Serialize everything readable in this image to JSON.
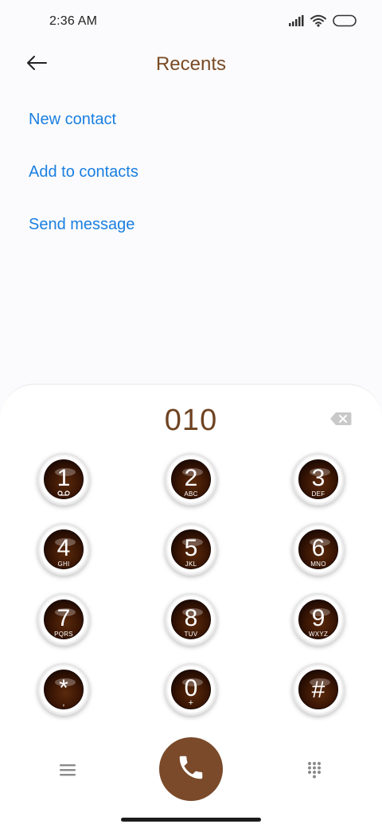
{
  "status_bar": {
    "time": "2:36 AM",
    "icons": [
      "signal-icon",
      "wifi-icon",
      "battery-icon"
    ]
  },
  "header": {
    "title": "Recents",
    "back_icon": "back-arrow-icon"
  },
  "options": [
    {
      "label": "New contact"
    },
    {
      "label": "Add to contacts"
    },
    {
      "label": "Send message"
    }
  ],
  "dialer": {
    "number": "010",
    "backspace_icon": "backspace-icon",
    "keys": [
      {
        "digit": "1",
        "letters": "voicemail"
      },
      {
        "digit": "2",
        "letters": "ABC"
      },
      {
        "digit": "3",
        "letters": "DEF"
      },
      {
        "digit": "4",
        "letters": "GHI"
      },
      {
        "digit": "5",
        "letters": "JKL"
      },
      {
        "digit": "6",
        "letters": "MNO"
      },
      {
        "digit": "7",
        "letters": "PQRS"
      },
      {
        "digit": "8",
        "letters": "TUV"
      },
      {
        "digit": "9",
        "letters": "WXYZ"
      },
      {
        "digit": "*",
        "letters": ","
      },
      {
        "digit": "0",
        "letters": "+"
      },
      {
        "digit": "#",
        "letters": ""
      }
    ]
  },
  "bottom_bar": {
    "menu_icon": "menu-icon",
    "call_icon": "phone-icon",
    "keypad_icon": "dialpad-icon"
  },
  "colors": {
    "accent_brown": "#7a4a2a",
    "title_brown": "#7a4a24",
    "link_blue": "#1a7fe0",
    "key_dark": "#3b1604"
  }
}
